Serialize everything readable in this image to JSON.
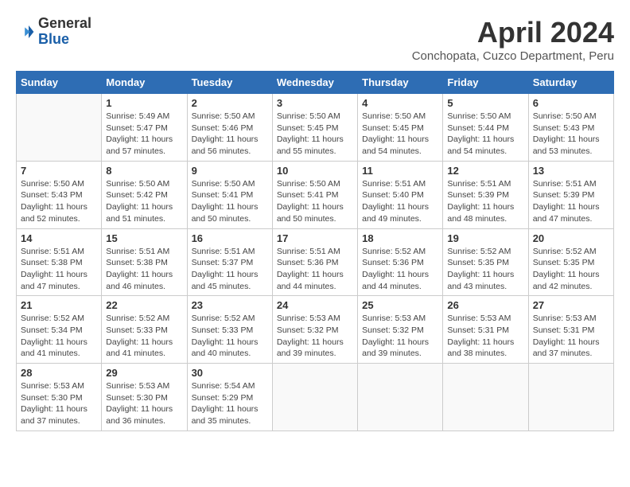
{
  "logo": {
    "general": "General",
    "blue": "Blue"
  },
  "title": "April 2024",
  "location": "Conchopata, Cuzco Department, Peru",
  "weekdays": [
    "Sunday",
    "Monday",
    "Tuesday",
    "Wednesday",
    "Thursday",
    "Friday",
    "Saturday"
  ],
  "weeks": [
    [
      {
        "day": "",
        "sunrise": "",
        "sunset": "",
        "daylight": ""
      },
      {
        "day": "1",
        "sunrise": "Sunrise: 5:49 AM",
        "sunset": "Sunset: 5:47 PM",
        "daylight": "Daylight: 11 hours and 57 minutes."
      },
      {
        "day": "2",
        "sunrise": "Sunrise: 5:50 AM",
        "sunset": "Sunset: 5:46 PM",
        "daylight": "Daylight: 11 hours and 56 minutes."
      },
      {
        "day": "3",
        "sunrise": "Sunrise: 5:50 AM",
        "sunset": "Sunset: 5:45 PM",
        "daylight": "Daylight: 11 hours and 55 minutes."
      },
      {
        "day": "4",
        "sunrise": "Sunrise: 5:50 AM",
        "sunset": "Sunset: 5:45 PM",
        "daylight": "Daylight: 11 hours and 54 minutes."
      },
      {
        "day": "5",
        "sunrise": "Sunrise: 5:50 AM",
        "sunset": "Sunset: 5:44 PM",
        "daylight": "Daylight: 11 hours and 54 minutes."
      },
      {
        "day": "6",
        "sunrise": "Sunrise: 5:50 AM",
        "sunset": "Sunset: 5:43 PM",
        "daylight": "Daylight: 11 hours and 53 minutes."
      }
    ],
    [
      {
        "day": "7",
        "sunrise": "Sunrise: 5:50 AM",
        "sunset": "Sunset: 5:43 PM",
        "daylight": "Daylight: 11 hours and 52 minutes."
      },
      {
        "day": "8",
        "sunrise": "Sunrise: 5:50 AM",
        "sunset": "Sunset: 5:42 PM",
        "daylight": "Daylight: 11 hours and 51 minutes."
      },
      {
        "day": "9",
        "sunrise": "Sunrise: 5:50 AM",
        "sunset": "Sunset: 5:41 PM",
        "daylight": "Daylight: 11 hours and 50 minutes."
      },
      {
        "day": "10",
        "sunrise": "Sunrise: 5:50 AM",
        "sunset": "Sunset: 5:41 PM",
        "daylight": "Daylight: 11 hours and 50 minutes."
      },
      {
        "day": "11",
        "sunrise": "Sunrise: 5:51 AM",
        "sunset": "Sunset: 5:40 PM",
        "daylight": "Daylight: 11 hours and 49 minutes."
      },
      {
        "day": "12",
        "sunrise": "Sunrise: 5:51 AM",
        "sunset": "Sunset: 5:39 PM",
        "daylight": "Daylight: 11 hours and 48 minutes."
      },
      {
        "day": "13",
        "sunrise": "Sunrise: 5:51 AM",
        "sunset": "Sunset: 5:39 PM",
        "daylight": "Daylight: 11 hours and 47 minutes."
      }
    ],
    [
      {
        "day": "14",
        "sunrise": "Sunrise: 5:51 AM",
        "sunset": "Sunset: 5:38 PM",
        "daylight": "Daylight: 11 hours and 47 minutes."
      },
      {
        "day": "15",
        "sunrise": "Sunrise: 5:51 AM",
        "sunset": "Sunset: 5:38 PM",
        "daylight": "Daylight: 11 hours and 46 minutes."
      },
      {
        "day": "16",
        "sunrise": "Sunrise: 5:51 AM",
        "sunset": "Sunset: 5:37 PM",
        "daylight": "Daylight: 11 hours and 45 minutes."
      },
      {
        "day": "17",
        "sunrise": "Sunrise: 5:51 AM",
        "sunset": "Sunset: 5:36 PM",
        "daylight": "Daylight: 11 hours and 44 minutes."
      },
      {
        "day": "18",
        "sunrise": "Sunrise: 5:52 AM",
        "sunset": "Sunset: 5:36 PM",
        "daylight": "Daylight: 11 hours and 44 minutes."
      },
      {
        "day": "19",
        "sunrise": "Sunrise: 5:52 AM",
        "sunset": "Sunset: 5:35 PM",
        "daylight": "Daylight: 11 hours and 43 minutes."
      },
      {
        "day": "20",
        "sunrise": "Sunrise: 5:52 AM",
        "sunset": "Sunset: 5:35 PM",
        "daylight": "Daylight: 11 hours and 42 minutes."
      }
    ],
    [
      {
        "day": "21",
        "sunrise": "Sunrise: 5:52 AM",
        "sunset": "Sunset: 5:34 PM",
        "daylight": "Daylight: 11 hours and 41 minutes."
      },
      {
        "day": "22",
        "sunrise": "Sunrise: 5:52 AM",
        "sunset": "Sunset: 5:33 PM",
        "daylight": "Daylight: 11 hours and 41 minutes."
      },
      {
        "day": "23",
        "sunrise": "Sunrise: 5:52 AM",
        "sunset": "Sunset: 5:33 PM",
        "daylight": "Daylight: 11 hours and 40 minutes."
      },
      {
        "day": "24",
        "sunrise": "Sunrise: 5:53 AM",
        "sunset": "Sunset: 5:32 PM",
        "daylight": "Daylight: 11 hours and 39 minutes."
      },
      {
        "day": "25",
        "sunrise": "Sunrise: 5:53 AM",
        "sunset": "Sunset: 5:32 PM",
        "daylight": "Daylight: 11 hours and 39 minutes."
      },
      {
        "day": "26",
        "sunrise": "Sunrise: 5:53 AM",
        "sunset": "Sunset: 5:31 PM",
        "daylight": "Daylight: 11 hours and 38 minutes."
      },
      {
        "day": "27",
        "sunrise": "Sunrise: 5:53 AM",
        "sunset": "Sunset: 5:31 PM",
        "daylight": "Daylight: 11 hours and 37 minutes."
      }
    ],
    [
      {
        "day": "28",
        "sunrise": "Sunrise: 5:53 AM",
        "sunset": "Sunset: 5:30 PM",
        "daylight": "Daylight: 11 hours and 37 minutes."
      },
      {
        "day": "29",
        "sunrise": "Sunrise: 5:53 AM",
        "sunset": "Sunset: 5:30 PM",
        "daylight": "Daylight: 11 hours and 36 minutes."
      },
      {
        "day": "30",
        "sunrise": "Sunrise: 5:54 AM",
        "sunset": "Sunset: 5:29 PM",
        "daylight": "Daylight: 11 hours and 35 minutes."
      },
      {
        "day": "",
        "sunrise": "",
        "sunset": "",
        "daylight": ""
      },
      {
        "day": "",
        "sunrise": "",
        "sunset": "",
        "daylight": ""
      },
      {
        "day": "",
        "sunrise": "",
        "sunset": "",
        "daylight": ""
      },
      {
        "day": "",
        "sunrise": "",
        "sunset": "",
        "daylight": ""
      }
    ]
  ]
}
